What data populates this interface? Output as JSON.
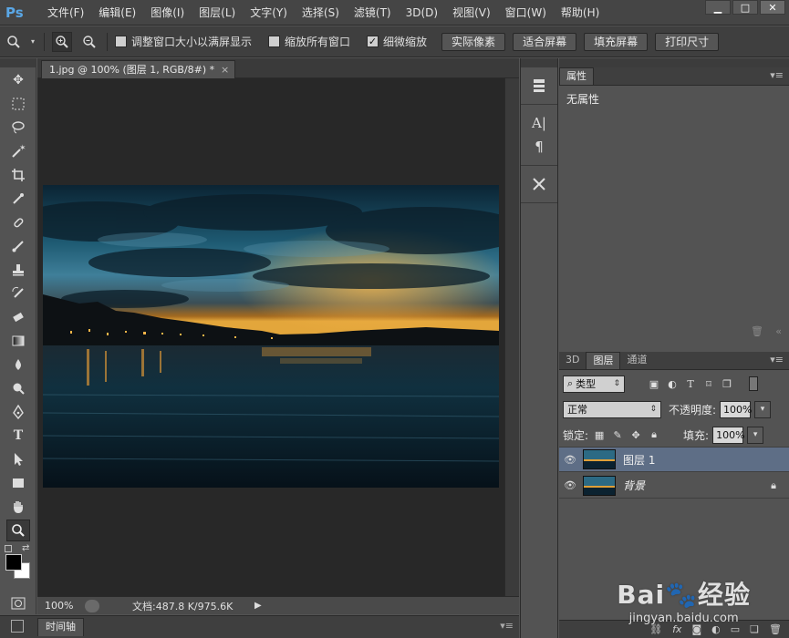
{
  "app": {
    "logo": "Ps"
  },
  "menu": [
    "文件(F)",
    "编辑(E)",
    "图像(I)",
    "图层(L)",
    "文字(Y)",
    "选择(S)",
    "滤镜(T)",
    "3D(D)",
    "视图(V)",
    "窗口(W)",
    "帮助(H)"
  ],
  "window_controls": {
    "minimize": "▁",
    "maximize": "□",
    "close": "✕"
  },
  "options": {
    "zoom_in": "⊕",
    "zoom_out": "⊖",
    "resize_windows": {
      "label": "调整窗口大小以满屏显示",
      "checked": false
    },
    "zoom_all": {
      "label": "缩放所有窗口",
      "checked": false
    },
    "scrubby": {
      "label": "细微缩放",
      "checked": true,
      "mark": "✓"
    },
    "buttons": [
      "实际像素",
      "适合屏幕",
      "填充屏幕",
      "打印尺寸"
    ]
  },
  "document": {
    "tab_title": "1.jpg @ 100% (图层 1, RGB/8#) *",
    "tab_close": "×",
    "zoom": "100%",
    "doc_info": "文档:487.8 K/975.6K"
  },
  "timeline": {
    "label": "时间轴",
    "menu": "▾≡"
  },
  "properties": {
    "tab": "属性",
    "empty_text": "无属性"
  },
  "layers_panel": {
    "tabs": [
      "3D",
      "图层",
      "通道"
    ],
    "filter_kind": "类型",
    "blend_mode": "正常",
    "opacity_label": "不透明度:",
    "opacity_value": "100%",
    "lock_label": "锁定:",
    "fill_label": "填充:",
    "fill_value": "100%",
    "layers": [
      {
        "name": "图层 1",
        "selected": true,
        "locked": false
      },
      {
        "name": "背景",
        "selected": false,
        "locked": true
      }
    ]
  },
  "watermark": {
    "logo": "Bai🐾经验",
    "url": "jingyan.baidu.com"
  },
  "colors": {
    "selected_layer": "#5e6e86",
    "ps_blue": "#5aa7e6"
  }
}
